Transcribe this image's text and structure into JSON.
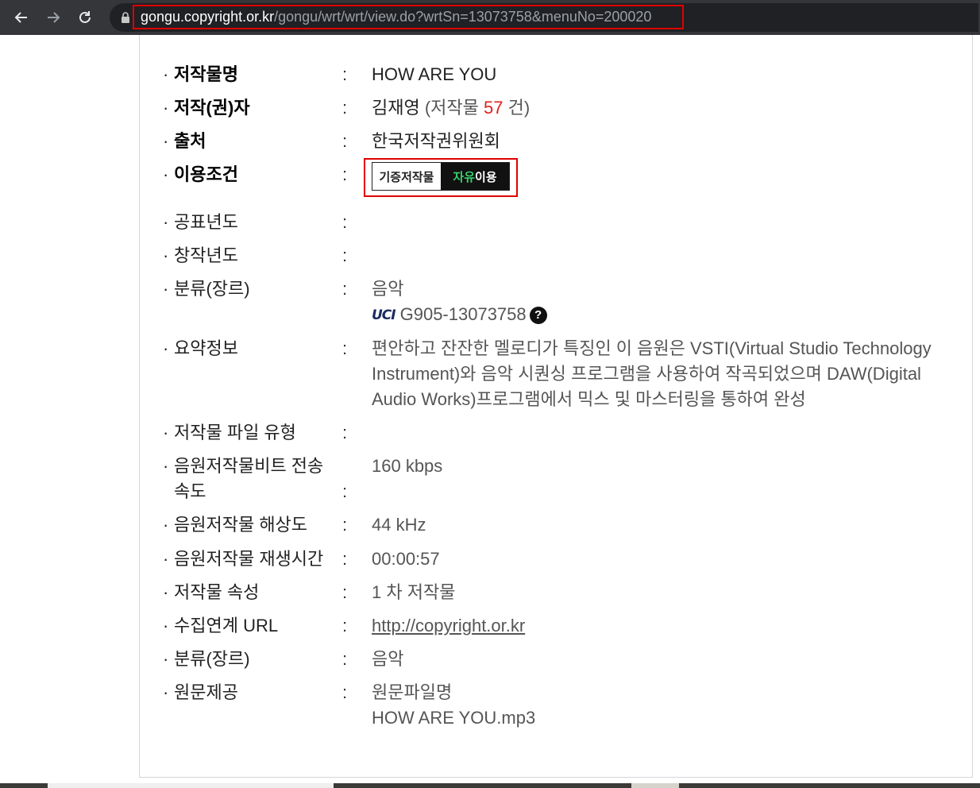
{
  "browser": {
    "url_host": "gongu.copyright.or.kr",
    "url_path": "/gongu/wrt/wrt/view.do?wrtSn=13073758&menuNo=200020"
  },
  "details": {
    "title": {
      "label": "저작물명",
      "value": "HOW ARE YOU"
    },
    "author": {
      "label": "저작(권)자",
      "name": "김재영",
      "count_prefix": "(저작물",
      "count": "57",
      "count_suffix": "건)"
    },
    "source": {
      "label": "출처",
      "value": "한국저작권위원회"
    },
    "usage": {
      "label": "이용조건",
      "badge_left": "기증저작물",
      "badge_right_green": "자유",
      "badge_right_white": "이용"
    },
    "pub_year": {
      "label": "공표년도",
      "value": ""
    },
    "create_year": {
      "label": "창작년도",
      "value": ""
    },
    "genre1": {
      "label": "분류(장르)",
      "value": "음악",
      "uci_logo": "UCI",
      "uci_code": "G905-13073758",
      "help": "?"
    },
    "summary": {
      "label": "요약정보",
      "value": "편안하고 잔잔한 멜로디가 특징인 이 음원은 VSTI(Virtual Studio Technology Instrument)와 음악 시퀀싱 프로그램을 사용하여 작곡되었으며 DAW(Digital Audio Works)프로그램에서 믹스 및 마스터링을 통하여 완성"
    },
    "file_type": {
      "label": "저작물 파일 유형",
      "value": ""
    },
    "bitrate": {
      "label": "음원저작물비트 전송속도",
      "value": "160 kbps"
    },
    "resolution": {
      "label": "음원저작물 해상도",
      "value": "44 kHz"
    },
    "duration": {
      "label": "음원저작물 재생시간",
      "value": "00:00:57"
    },
    "attribute": {
      "label": "저작물 속성",
      "value": "1 차 저작물"
    },
    "collect_url": {
      "label": "수집연계 URL",
      "value": "http://copyright.or.kr"
    },
    "genre2": {
      "label": "분류(장르)",
      "value": "음악"
    },
    "original": {
      "label": "원문제공",
      "value_line1": "원문파일명",
      "value_line2": "HOW ARE YOU.mp3"
    }
  },
  "common": {
    "bullet": "·",
    "colon": ":"
  }
}
